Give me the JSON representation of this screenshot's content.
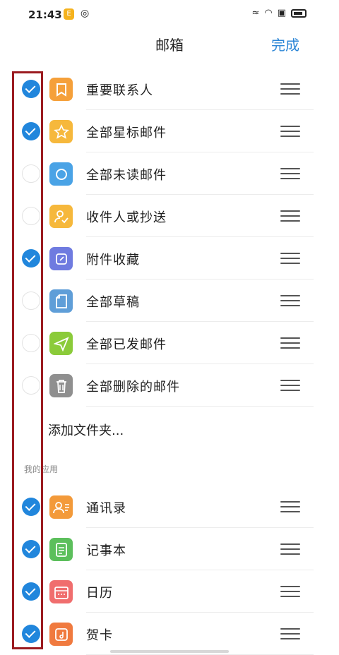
{
  "status_bar": {
    "time": "21:43",
    "app_badge": "E"
  },
  "header": {
    "title": "邮箱",
    "done_label": "完成"
  },
  "mailbox_items": [
    {
      "label": "重要联系人",
      "checked": true,
      "icon": "bookmark-icon",
      "color": "#f5a03a"
    },
    {
      "label": "全部星标邮件",
      "checked": true,
      "icon": "star-icon",
      "color": "#f6b83c"
    },
    {
      "label": "全部未读邮件",
      "checked": false,
      "icon": "circle-icon",
      "color": "#4aa3e6"
    },
    {
      "label": "收件人或抄送",
      "checked": false,
      "icon": "user-check-icon",
      "color": "#f6b83c"
    },
    {
      "label": "附件收藏",
      "checked": true,
      "icon": "attachment-icon",
      "color": "#6f7be0"
    },
    {
      "label": "全部草稿",
      "checked": false,
      "icon": "draft-icon",
      "color": "#5f9ed8"
    },
    {
      "label": "全部已发邮件",
      "checked": false,
      "icon": "send-icon",
      "color": "#8bcb3a"
    },
    {
      "label": "全部删除的邮件",
      "checked": false,
      "icon": "trash-icon",
      "color": "#8f8f8f"
    }
  ],
  "add_folder_label": "添加文件夹...",
  "apps_section_label": "我的应用",
  "app_items": [
    {
      "label": "通讯录",
      "checked": true,
      "icon": "contacts-icon",
      "color": "#f39a3a"
    },
    {
      "label": "记事本",
      "checked": true,
      "icon": "notepad-icon",
      "color": "#5cbf5c"
    },
    {
      "label": "日历",
      "checked": true,
      "icon": "calendar-icon",
      "color": "#f06e6e"
    },
    {
      "label": "贺卡",
      "checked": true,
      "icon": "card-icon",
      "color": "#f07a3f"
    }
  ]
}
